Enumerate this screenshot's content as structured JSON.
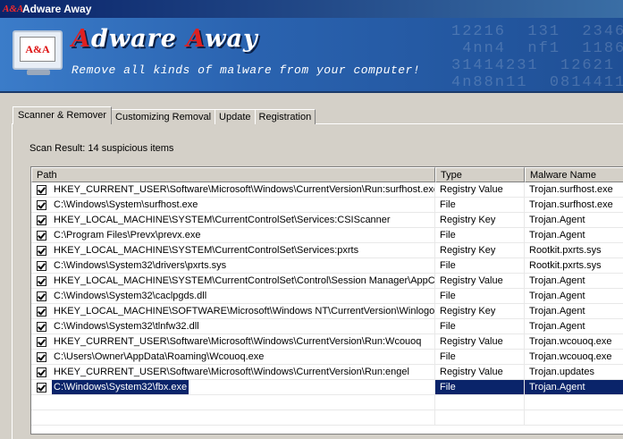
{
  "window": {
    "title": "Adware Away",
    "icon_text": "A&A"
  },
  "banner": {
    "logo_text": "A&A",
    "brand_first_cap": "A",
    "brand_first_rest": "dware",
    "brand_second_cap": "A",
    "brand_second_rest": "way",
    "tagline": "Remove all kinds of malware from your computer!",
    "bg_numbers": "12216  131  2346\n 4nn4  nf1  1186\n31414231  12621\n4n88n11  0814411"
  },
  "tabs": [
    {
      "label": "Scanner & Remover",
      "active": true
    },
    {
      "label": "Customizing Removal",
      "active": false
    },
    {
      "label": "Update",
      "active": false
    },
    {
      "label": "Registration",
      "active": false
    }
  ],
  "scan_result": "Scan Result: 14 suspicious items",
  "table": {
    "columns": [
      "Path",
      "Type",
      "Malware Name"
    ],
    "rows": [
      {
        "path": "HKEY_CURRENT_USER\\Software\\Microsoft\\Windows\\CurrentVersion\\Run:surfhost.exe",
        "type": "Registry Value",
        "name": "Trojan.surfhost.exe",
        "checked": true
      },
      {
        "path": "C:\\Windows\\System\\surfhost.exe",
        "type": "File",
        "name": "Trojan.surfhost.exe",
        "checked": true
      },
      {
        "path": "HKEY_LOCAL_MACHINE\\SYSTEM\\CurrentControlSet\\Services:CSIScanner",
        "type": "Registry Key",
        "name": "Trojan.Agent",
        "checked": true
      },
      {
        "path": "C:\\Program Files\\Prevx\\prevx.exe",
        "type": "File",
        "name": "Trojan.Agent",
        "checked": true
      },
      {
        "path": "HKEY_LOCAL_MACHINE\\SYSTEM\\CurrentControlSet\\Services:pxrts",
        "type": "Registry Key",
        "name": "Rootkit.pxrts.sys",
        "checked": true
      },
      {
        "path": "C:\\Windows\\System32\\drivers\\pxrts.sys",
        "type": "File",
        "name": "Rootkit.pxrts.sys",
        "checked": true
      },
      {
        "path": "HKEY_LOCAL_MACHINE\\SYSTEM\\CurrentControlSet\\Control\\Session Manager\\AppCe...",
        "type": "Registry Value",
        "name": "Trojan.Agent",
        "checked": true
      },
      {
        "path": "C:\\Windows\\System32\\caclpgds.dll",
        "type": "File",
        "name": "Trojan.Agent",
        "checked": true
      },
      {
        "path": "HKEY_LOCAL_MACHINE\\SOFTWARE\\Microsoft\\Windows NT\\CurrentVersion\\Winlogon...",
        "type": "Registry Key",
        "name": "Trojan.Agent",
        "checked": true
      },
      {
        "path": "C:\\Windows\\System32\\tlnfw32.dll",
        "type": "File",
        "name": "Trojan.Agent",
        "checked": true
      },
      {
        "path": "HKEY_CURRENT_USER\\Software\\Microsoft\\Windows\\CurrentVersion\\Run:Wcouoq",
        "type": "Registry Value",
        "name": "Trojan.wcouoq.exe",
        "checked": true
      },
      {
        "path": "C:\\Users\\Owner\\AppData\\Roaming\\Wcouoq.exe",
        "type": "File",
        "name": "Trojan.wcouoq.exe",
        "checked": true
      },
      {
        "path": "HKEY_CURRENT_USER\\Software\\Microsoft\\Windows\\CurrentVersion\\Run:engel",
        "type": "Registry Value",
        "name": "Trojan.updates",
        "checked": true
      },
      {
        "path": "C:\\Windows\\System32\\fbx.exe",
        "type": "File",
        "name": "Trojan.Agent",
        "checked": true,
        "selected": true
      }
    ]
  },
  "colors": {
    "selection": "#0a246a",
    "title_bar": "#0a246a",
    "brand_accent": "#e02020"
  }
}
